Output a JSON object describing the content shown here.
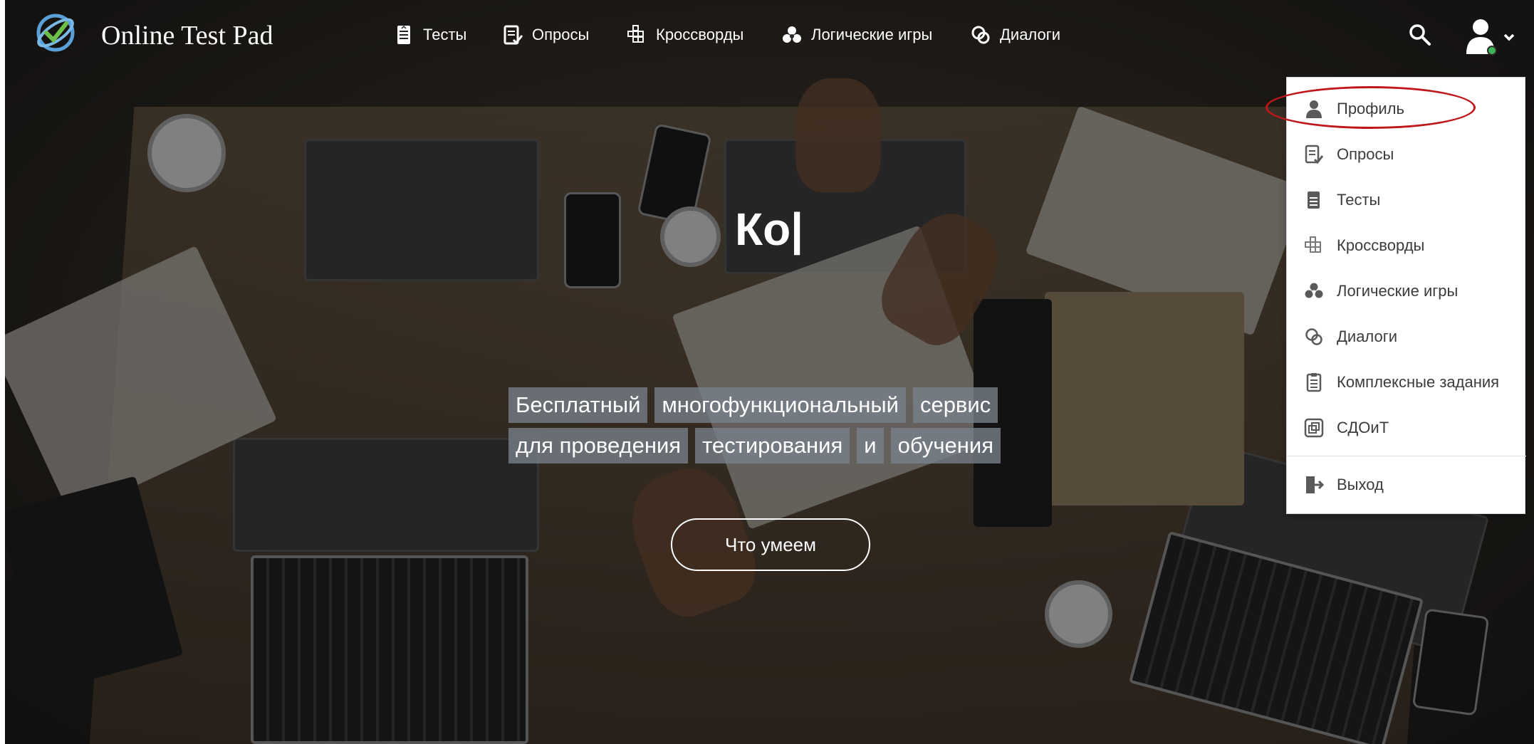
{
  "header": {
    "logo_text": "Online Test Pad",
    "nav": [
      {
        "label": "Тесты",
        "icon": "test-doc-icon"
      },
      {
        "label": "Опросы",
        "icon": "poll-icon"
      },
      {
        "label": "Кроссворды",
        "icon": "crossword-icon"
      },
      {
        "label": "Логические игры",
        "icon": "logic-games-icon"
      },
      {
        "label": "Диалоги",
        "icon": "dialogs-icon"
      }
    ]
  },
  "hero": {
    "typed_text": "Ко|",
    "tagline_line1": [
      "Бесплатный",
      "многофункциональный",
      "сервис"
    ],
    "tagline_line2": [
      "для проведения",
      "тестирования",
      "и",
      "обучения"
    ],
    "cta_label": "Что умеем"
  },
  "user_menu": {
    "items": [
      {
        "label": "Профиль",
        "icon": "profile-icon"
      },
      {
        "label": "Опросы",
        "icon": "poll-icon"
      },
      {
        "label": "Тесты",
        "icon": "test-doc-icon"
      },
      {
        "label": "Кроссворды",
        "icon": "crossword-icon"
      },
      {
        "label": "Логические игры",
        "icon": "logic-games-icon"
      },
      {
        "label": "Диалоги",
        "icon": "dialogs-icon"
      },
      {
        "label": "Комплексные задания",
        "icon": "complex-tasks-icon"
      },
      {
        "label": "СДОиТ",
        "icon": "sdoit-icon"
      },
      {
        "label": "Выход",
        "icon": "logout-icon"
      }
    ]
  },
  "colors": {
    "highlight_annotation": "#c0171a",
    "menu_text": "#3c3c3c",
    "icon_gray": "#5a5a5a",
    "chip_background": "#78828c"
  }
}
